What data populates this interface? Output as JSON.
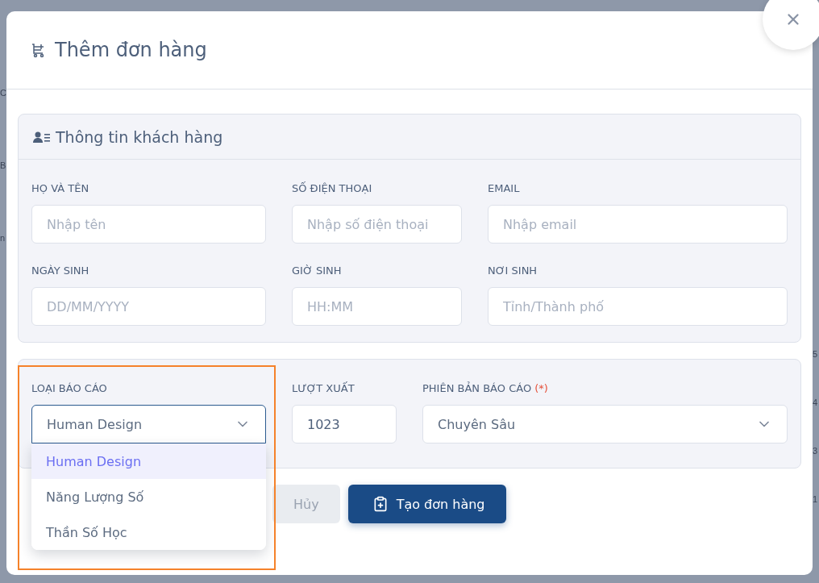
{
  "background_page": {
    "left_fragments": [
      "C",
      "B",
      "n"
    ],
    "right_fragments": [
      "5",
      "4",
      "3",
      "1"
    ]
  },
  "dialog": {
    "title": "Thêm đơn hàng"
  },
  "customer_section": {
    "title": "Thông tin khách hàng",
    "fields": [
      {
        "label": "HỌ VÀ TÊN",
        "placeholder": "Nhập tên"
      },
      {
        "label": "SỐ ĐIỆN THOẠI",
        "placeholder": "Nhập số điện thoại"
      },
      {
        "label": "EMAIL",
        "placeholder": "Nhập email"
      },
      {
        "label": "NGÀY SINH",
        "placeholder": "DD/MM/YYYY"
      },
      {
        "label": "GIỜ SINH",
        "placeholder": "HH:MM"
      },
      {
        "label": "NƠI SINH",
        "placeholder": "Tỉnh/Thành phố"
      }
    ]
  },
  "report_section": {
    "fields": [
      {
        "kind": "select",
        "label": "LOẠI BÁO CÁO",
        "value": "Human Design",
        "open": true,
        "options": [
          {
            "label": "Human Design",
            "selected": true
          },
          {
            "label": "Năng Lượng Số",
            "selected": false
          },
          {
            "label": "Thần Số Học",
            "selected": false
          }
        ]
      },
      {
        "kind": "input",
        "label": "LƯỢT XUẤT",
        "value": "1023"
      },
      {
        "kind": "select",
        "label": "PHIÊN BẢN BÁO CÁO",
        "required_mark": "(*)",
        "value": "Chuyên Sâu",
        "open": false
      }
    ]
  },
  "buttons": [
    {
      "kind": "secondary",
      "label": "Hủy"
    },
    {
      "kind": "primary",
      "label": "Tạo đơn hàng"
    }
  ]
}
